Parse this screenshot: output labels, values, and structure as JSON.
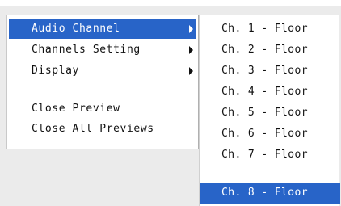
{
  "menu": {
    "items": [
      {
        "label": "Audio Channel",
        "submenu": true,
        "active": true
      },
      {
        "label": "Channels Setting",
        "submenu": true,
        "active": false
      },
      {
        "label": "Display",
        "submenu": true,
        "active": false
      },
      {
        "label": "Close Preview",
        "submenu": false,
        "active": false
      },
      {
        "label": "Close All Previews",
        "submenu": false,
        "active": false
      }
    ]
  },
  "submenu": {
    "items": [
      {
        "label": "Ch. 1 - Floor",
        "active": false
      },
      {
        "label": "Ch. 2 - Floor",
        "active": false
      },
      {
        "label": "Ch. 3 - Floor",
        "active": false
      },
      {
        "label": "Ch. 4 - Floor",
        "active": false
      },
      {
        "label": "Ch. 5 - Floor",
        "active": false
      },
      {
        "label": "Ch. 6 - Floor",
        "active": false
      },
      {
        "label": "Ch. 7 - Floor",
        "active": false
      },
      {
        "label": "Ch. 8 - Floor",
        "active": true
      }
    ]
  },
  "colors": {
    "highlight": "#2864c8",
    "backdrop": "#ebebeb"
  }
}
